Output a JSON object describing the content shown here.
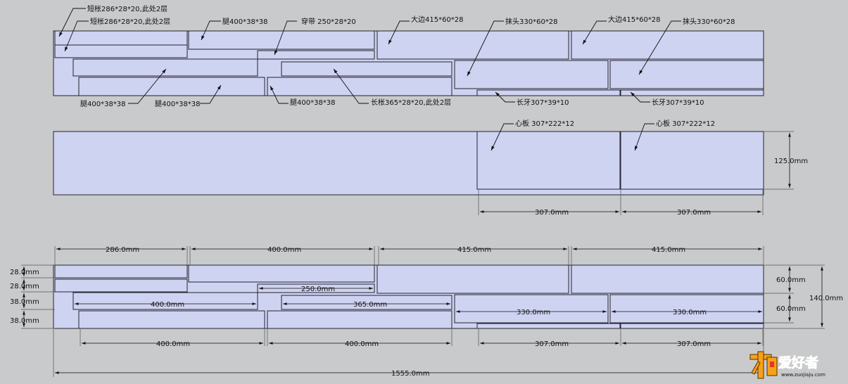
{
  "labels": {
    "short_rail_a": "短枨286*28*20,此处2层",
    "short_rail_b": "短枨286*28*20,此处2层",
    "leg_top": "腿400*38*38",
    "brace": "穿带 250*28*20",
    "side_1": "大边415*60*28",
    "end_1": "抹头330*60*28",
    "side_2": "大边415*60*28",
    "end_2": "抹头330*60*28",
    "leg_b1": "腿400*38*38",
    "leg_b2": "腿400*38*38",
    "leg_b3": "腿400*38*38",
    "long_rail": "长枨365*28*20,此处2层",
    "apron_1": "长牙307*39*10",
    "apron_2": "长牙307*39*10",
    "panel_1": "心板 307*222*12",
    "panel_2": "心板 307*222*12"
  },
  "dims": {
    "panel_h": "125.0mm",
    "panel_w1": "307.0mm",
    "panel_w2": "307.0mm",
    "top_286": "286.0mm",
    "top_400": "400.0mm",
    "top_415a": "415.0mm",
    "top_415b": "415.0mm",
    "left_28a": "28.0mm",
    "left_28b": "28.0mm",
    "left_38a": "38.0mm",
    "left_38b": "38.0mm",
    "in_250": "250.0mm",
    "in_400": "400.0mm",
    "in_365": "365.0mm",
    "in_330a": "330.0mm",
    "in_330b": "330.0mm",
    "right_60a": "60.0mm",
    "right_60b": "60.0mm",
    "right_140": "140.0mm",
    "bot_400a": "400.0mm",
    "bot_400b": "400.0mm",
    "bot_307a": "307.0mm",
    "bot_307b": "307.0mm",
    "total": "1555.0mm"
  },
  "watermark": {
    "brand": "爱好者",
    "url": "www.zuojiaju.com"
  },
  "colors": {
    "background": "#c9cacc",
    "board_fill": "#cfd3f2",
    "logo_orange": "#f5a21b",
    "logo_red": "#e8322b"
  }
}
